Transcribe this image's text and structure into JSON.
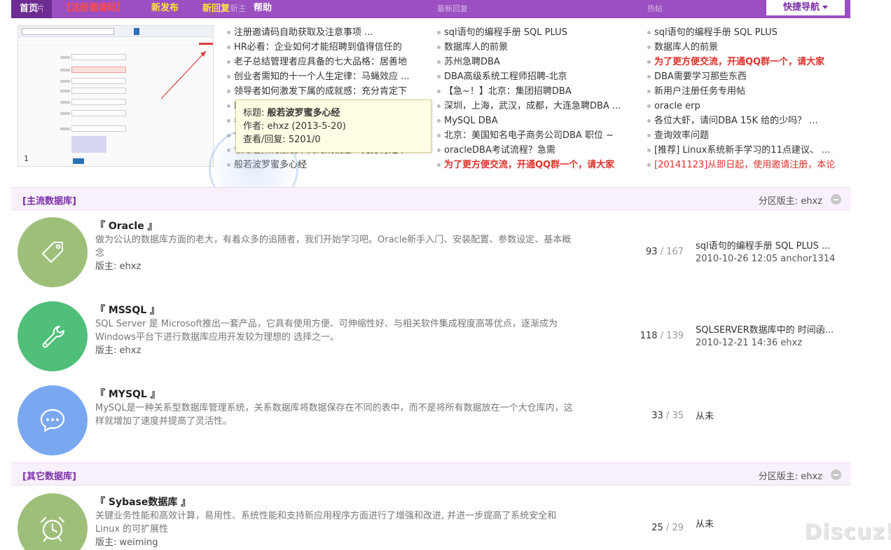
{
  "nav": {
    "home": "首页",
    "home_ghost": "片",
    "register": "【注册邀请码】",
    "new_posts": "新发布",
    "new_replies": "新回复",
    "new_replies_ghost": "新主",
    "help": "帮助",
    "col_latest_reply": "最新回复",
    "col_hot": "热帖",
    "quick_nav": "快捷导航"
  },
  "slide": {
    "page": "1"
  },
  "lists": {
    "col1": [
      {
        "text": "注册邀请码自助获取及注意事项 ..."
      },
      {
        "text": "HR必看：企业如何才能招聘到值得信任的"
      },
      {
        "text": "老子总结管理者应具备的七大品格：居善地"
      },
      {
        "text": "创业者需知的十一个人生定律：马蝇效应 ..."
      },
      {
        "text": "领导者如何激发下属的成就感：充分肯定下"
      },
      {
        "text": "HR必看：企业如何才能招聘到值得信任的"
      },
      {
        "text": "老子总结管理者应具备的七大品格：居善地"
      },
      {
        "text": "创业者需知的十一个人生定律：马蝇效应"
      },
      {
        "text": "领导者如何激发下属的成就感：充分肯定下"
      },
      {
        "text": "般若波罗蜜多心经"
      }
    ],
    "col2": [
      {
        "text": "sql语句的编程手册 SQL PLUS"
      },
      {
        "text": "数据库人的前景"
      },
      {
        "text": "苏州急聘DBA"
      },
      {
        "text": "DBA高级系统工程师招聘-北京"
      },
      {
        "text": "【急~！】北京：集团招聘DBA"
      },
      {
        "text": "深圳，上海，武汉，成都，大连急聘DBA ..."
      },
      {
        "text": "MySQL DBA"
      },
      {
        "text": "北京：美国知名电子商务公司DBA 职位 ~"
      },
      {
        "text": "oracleDBA考试流程？急需"
      },
      {
        "text": "为了更方便交流，开通QQ群一个，请大家",
        "style": "red"
      }
    ],
    "col3": [
      {
        "text": "sql语句的编程手册 SQL PLUS"
      },
      {
        "text": "数据库人的前景"
      },
      {
        "text": "为了更方便交流，开通QQ群一个，请大家",
        "style": "red"
      },
      {
        "text": "DBA需要学习那些东西"
      },
      {
        "text": "新用户注册任务专用帖"
      },
      {
        "text": "oracle erp"
      },
      {
        "text": "各位大虾，请问DBA 15K 给的少吗？ ..."
      },
      {
        "text": "查询效率问题"
      },
      {
        "text": "[推荐] Linux系统新手学习的11点建议、 ..."
      },
      {
        "text": "[20141123]从即日起，使用邀请注册，本论",
        "style": "red2"
      }
    ]
  },
  "tooltip": {
    "title_label": "标题: ",
    "title": "般若波罗蜜多心经",
    "author_line": "作者: ehxz (2013-5-20)",
    "stats_line": "查看/回复: 5201/0"
  },
  "categories": [
    {
      "title": "[主流数据库]",
      "mod_line": "分区版主: ehxz"
    },
    {
      "title": "[其它数据库]",
      "mod_line": "分区版主: ehxz"
    }
  ],
  "forums": [
    {
      "name": "『 Oracle 』",
      "desc": "做为公认的数据库方面的老大，有着众多的追随者，我们开始学习吧。Oracle新手入门、安装配置、参数设定、基本概念",
      "mod": "版主: ehxz",
      "threads": "93",
      "posts": "167",
      "last_title": "sql语句的编程手册 SQL PLUS ...",
      "last_time": "2010-10-26 12:05 anchor1314",
      "icon": "tag-icon",
      "color": "#9ebf7a"
    },
    {
      "name": "『 MSSQL 』",
      "desc": "SQL Server 是 Microsoft推出一套产品，它具有使用方便、可伸缩性好、与相关软件集成程度高等优点，逐渐成为Windows平台下进行数据库应用开发较为理想的 选择之一。",
      "mod": "版主: ehxz",
      "threads": "118",
      "posts": "139",
      "last_title": "SQLSERVER数据库中的 时间函...",
      "last_time": "2010-12-21 14:36 ehxz",
      "icon": "wrench-icon",
      "color": "#4fbf7a"
    },
    {
      "name": "『 MYSQL 』",
      "desc": "MySQL是一种关系型数据库管理系统，关系数据库将数据保存在不同的表中，而不是将所有数据放在一个大仓库内，这样就增加了速度并提高了灵活性。",
      "mod": "",
      "threads": "33",
      "posts": "35",
      "last_title": "从未",
      "last_time": "",
      "icon": "chat-icon",
      "color": "#7aa8f0"
    },
    {
      "name": "『 Sybase数据库 』",
      "desc": "关键业务性能和高效计算，易用性、系统性能和支持新应用程序方面进行了增强和改进, 并进一步提高了系统安全和 Linux 的可扩展性",
      "mod": "版主: weiming",
      "threads": "25",
      "posts": "29",
      "last_title": "从未",
      "last_time": "",
      "icon": "alarm-clock-icon",
      "color": "#9ebf7a"
    }
  ],
  "watermark": "Discuz!"
}
